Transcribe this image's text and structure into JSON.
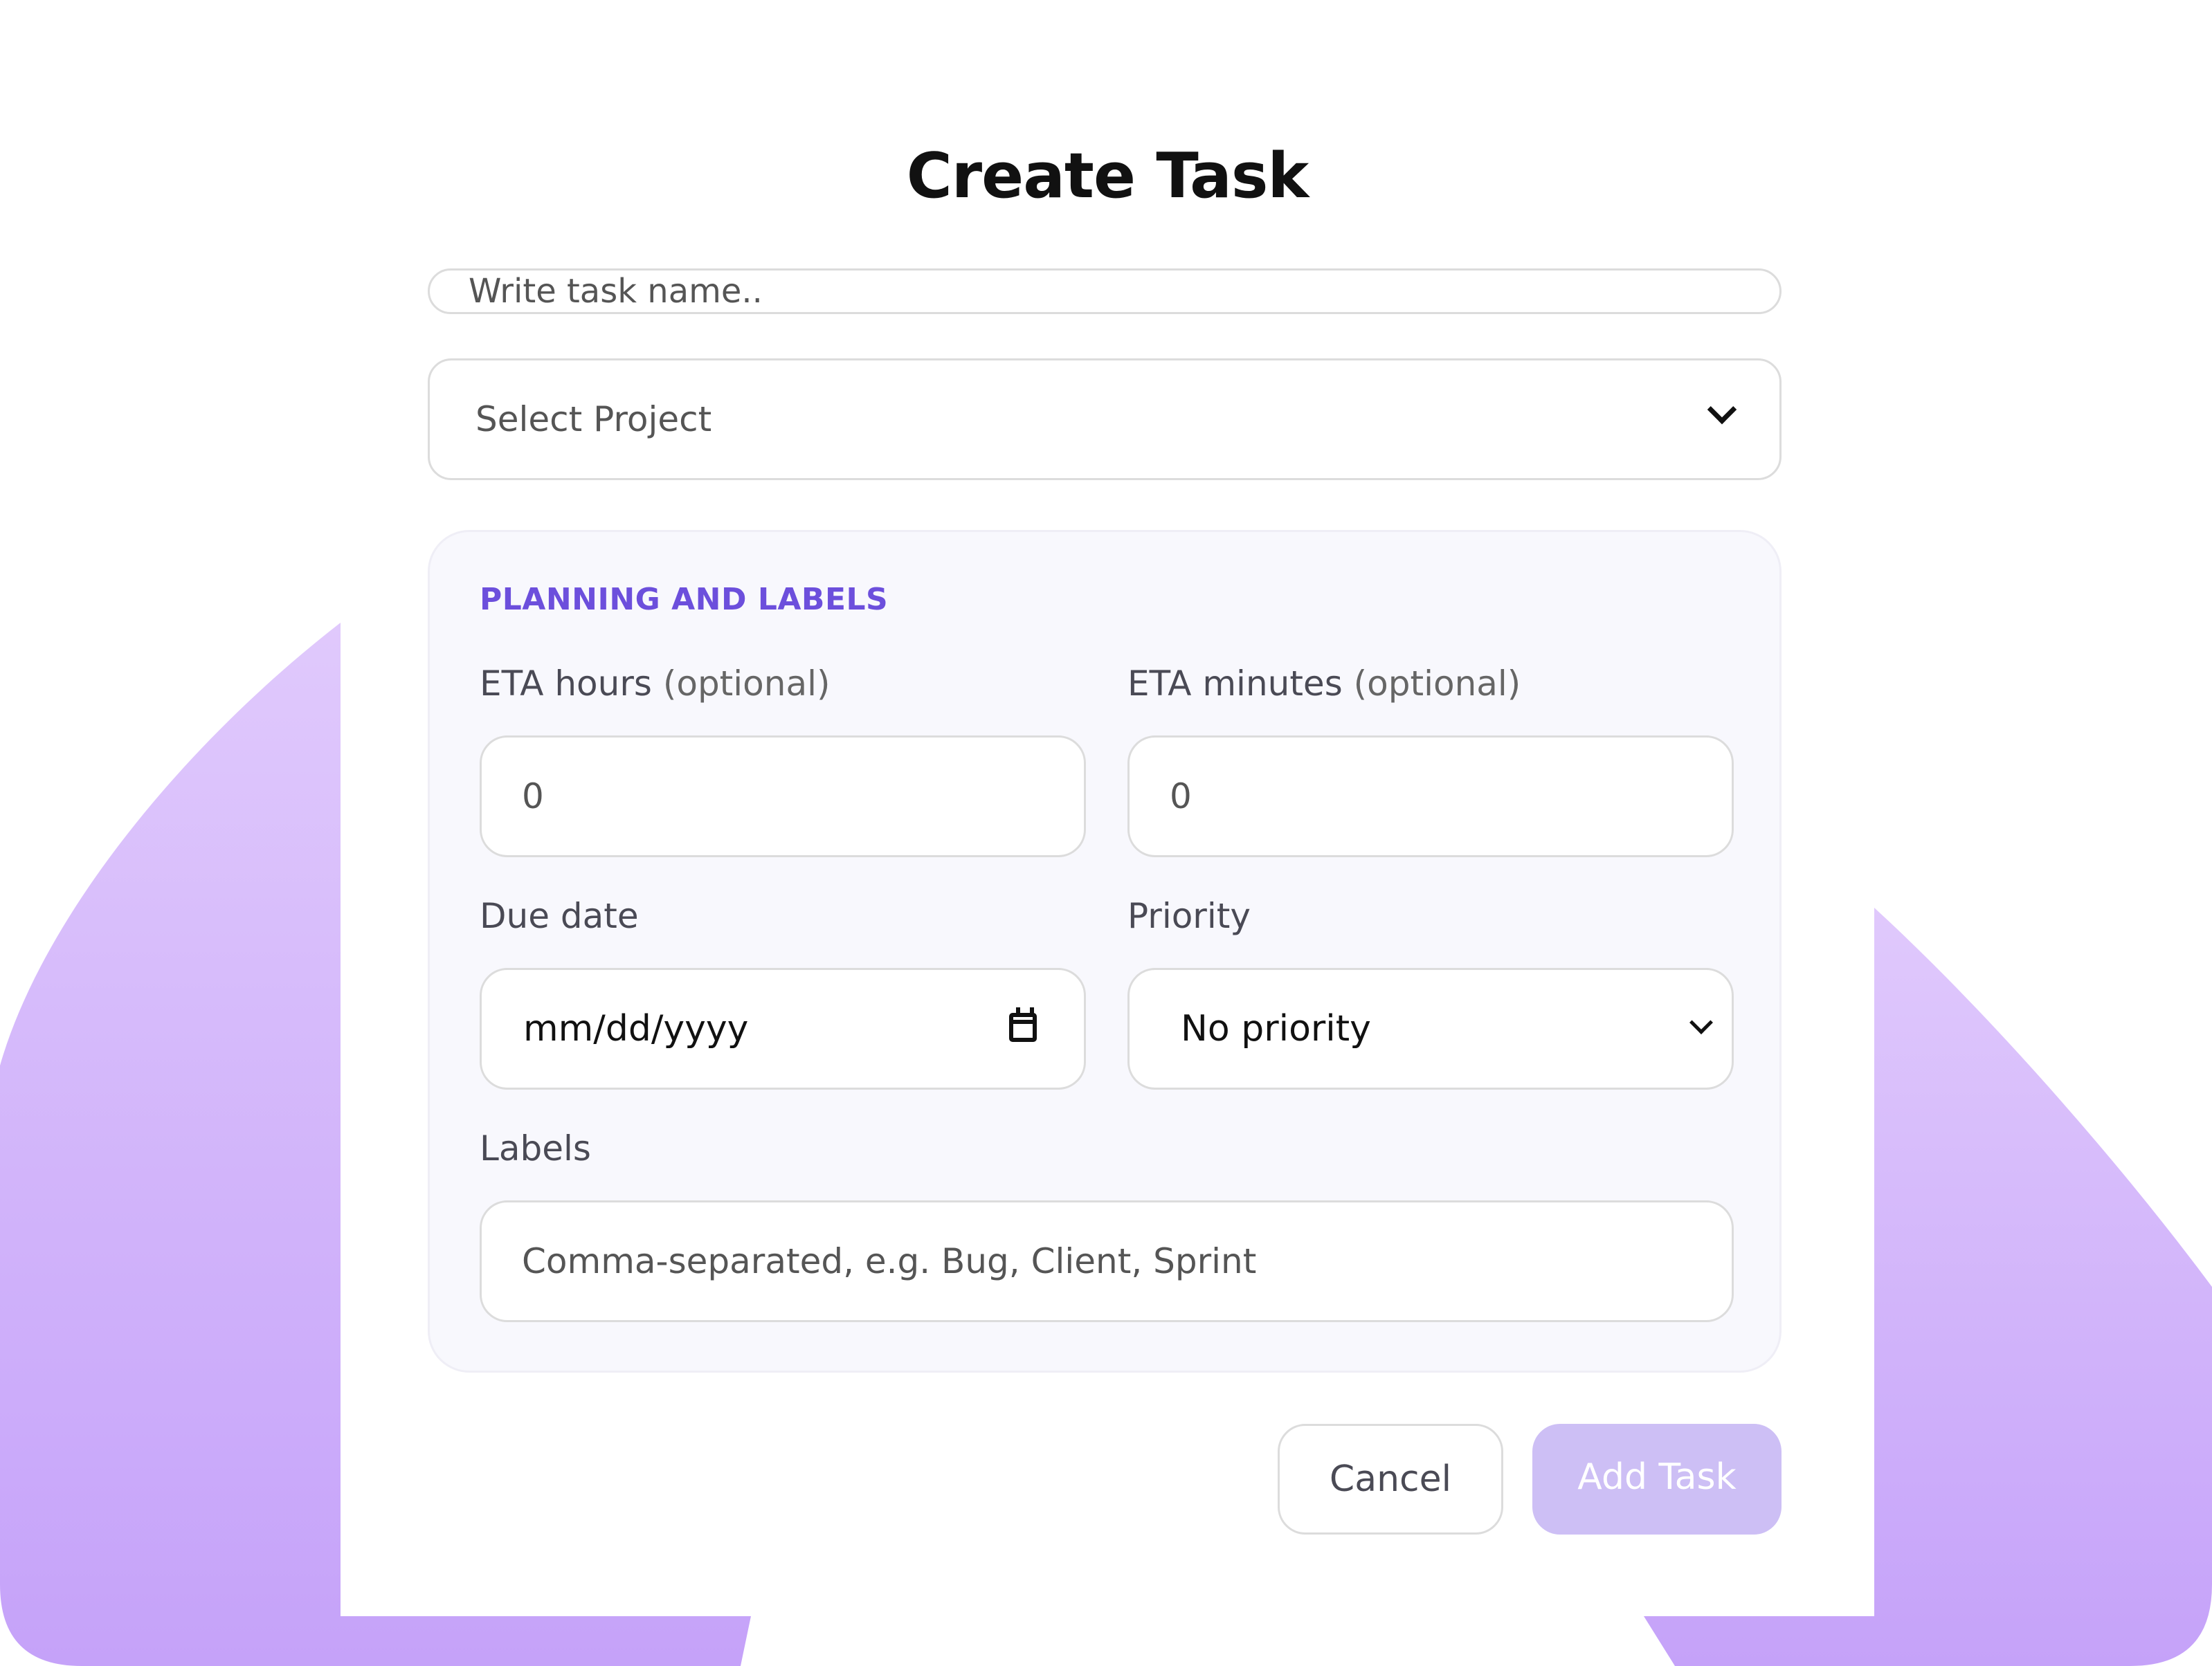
{
  "modal": {
    "title": "Create Task",
    "task_name_placeholder": "Write task name..",
    "select_project_label": "Select Project",
    "section_title": "PLANNING AND LABELS",
    "eta_hours": {
      "label": "ETA hours",
      "optional": "(optional)",
      "placeholder": "0"
    },
    "eta_minutes": {
      "label": "ETA minutes",
      "optional": "(optional)",
      "placeholder": "0"
    },
    "due_date": {
      "label": "Due date",
      "value": "mm/dd/yyyy"
    },
    "priority": {
      "label": "Priority",
      "value": "No priority"
    },
    "labels": {
      "label": "Labels",
      "placeholder": "Comma-separated, e.g. Bug, Client, Sprint"
    },
    "cancel_label": "Cancel",
    "add_label": "Add Task"
  },
  "colors": {
    "accent": "#6c4fdc",
    "add_button_disabled": "#cdbff5",
    "background_purple": "#c9a9fb"
  },
  "icons": {
    "project_dropdown": "chevron-down-icon",
    "due_date": "calendar-icon",
    "priority_dropdown": "chevron-down-icon"
  }
}
